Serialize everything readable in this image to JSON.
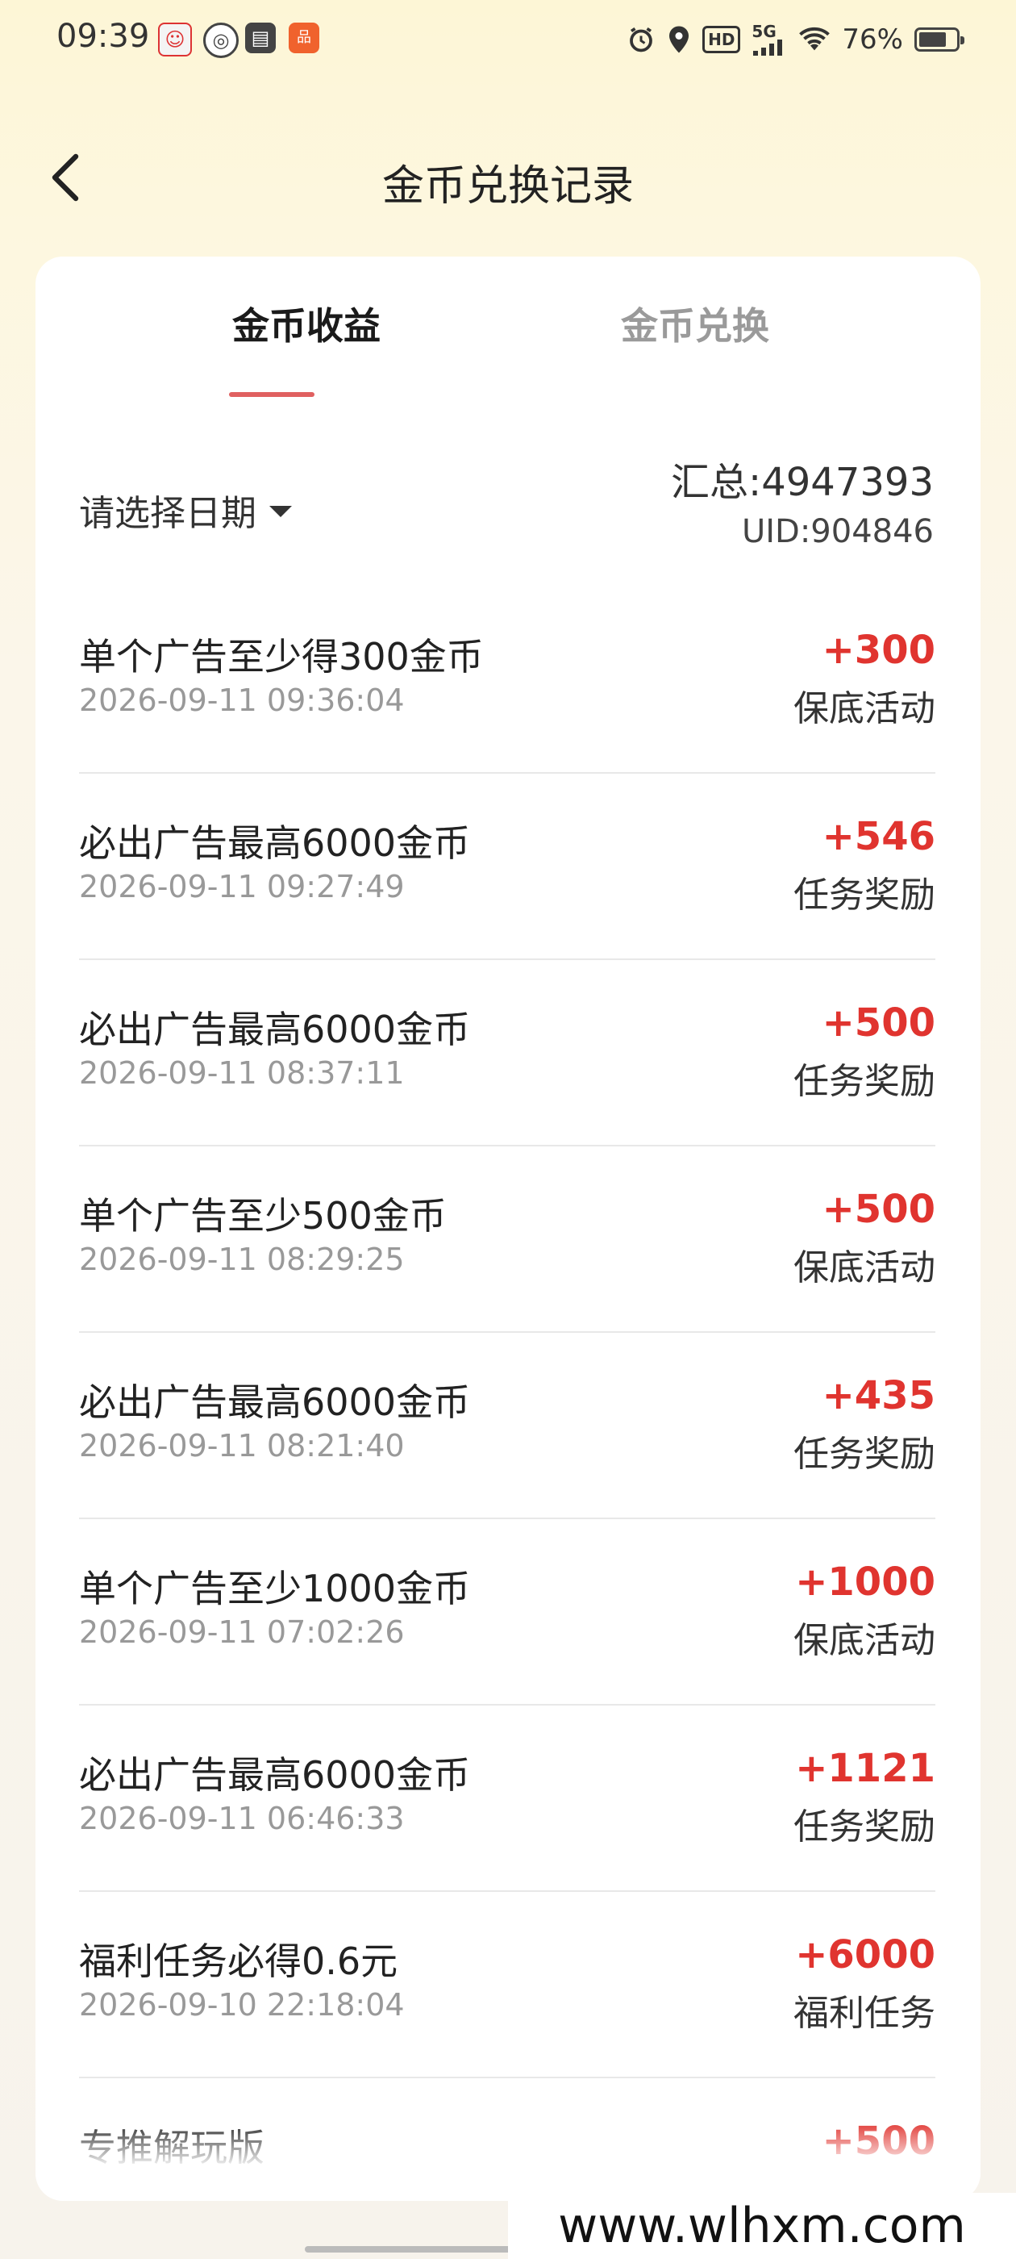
{
  "status_bar": {
    "time": "09:39",
    "battery": "76%",
    "battery_level": 0.76,
    "network": "5G",
    "hd": "HD",
    "icons": [
      "alarm-icon",
      "location-icon",
      "hd-icon",
      "5g-signal-icon",
      "wifi-icon",
      "battery-icon"
    ]
  },
  "header": {
    "title": "金币兑换记录",
    "back_icon": "chevron-left-icon"
  },
  "tabs": [
    {
      "label": "金币收益",
      "active": true
    },
    {
      "label": "金币兑换",
      "active": false
    }
  ],
  "filter": {
    "date_label": "请选择日期",
    "total": "汇总:4947393",
    "uid": "UID:904846"
  },
  "records": [
    {
      "title": "单个广告至少得300金币",
      "time": "2026-09-11 09:36:04",
      "amount": "+300",
      "type": "保底活动"
    },
    {
      "title": "必出广告最高6000金币",
      "time": "2026-09-11 09:27:49",
      "amount": "+546",
      "type": "任务奖励"
    },
    {
      "title": "必出广告最高6000金币",
      "time": "2026-09-11 08:37:11",
      "amount": "+500",
      "type": "任务奖励"
    },
    {
      "title": "单个广告至少500金币",
      "time": "2026-09-11 08:29:25",
      "amount": "+500",
      "type": "保底活动"
    },
    {
      "title": "必出广告最高6000金币",
      "time": "2026-09-11 08:21:40",
      "amount": "+435",
      "type": "任务奖励"
    },
    {
      "title": "单个广告至少1000金币",
      "time": "2026-09-11 07:02:26",
      "amount": "+1000",
      "type": "保底活动"
    },
    {
      "title": "必出广告最高6000金币",
      "time": "2026-09-11 06:46:33",
      "amount": "+1121",
      "type": "任务奖励"
    },
    {
      "title": "福利任务必得0.6元",
      "time": "2026-09-10 22:18:04",
      "amount": "+6000",
      "type": "福利任务"
    },
    {
      "title": "专推解玩版",
      "time": "",
      "amount": "+500",
      "type": ""
    }
  ],
  "watermark": "www.wlhxm.com",
  "colors": {
    "accent_red": "#e0342f",
    "tab_indicator": "#e06060"
  }
}
